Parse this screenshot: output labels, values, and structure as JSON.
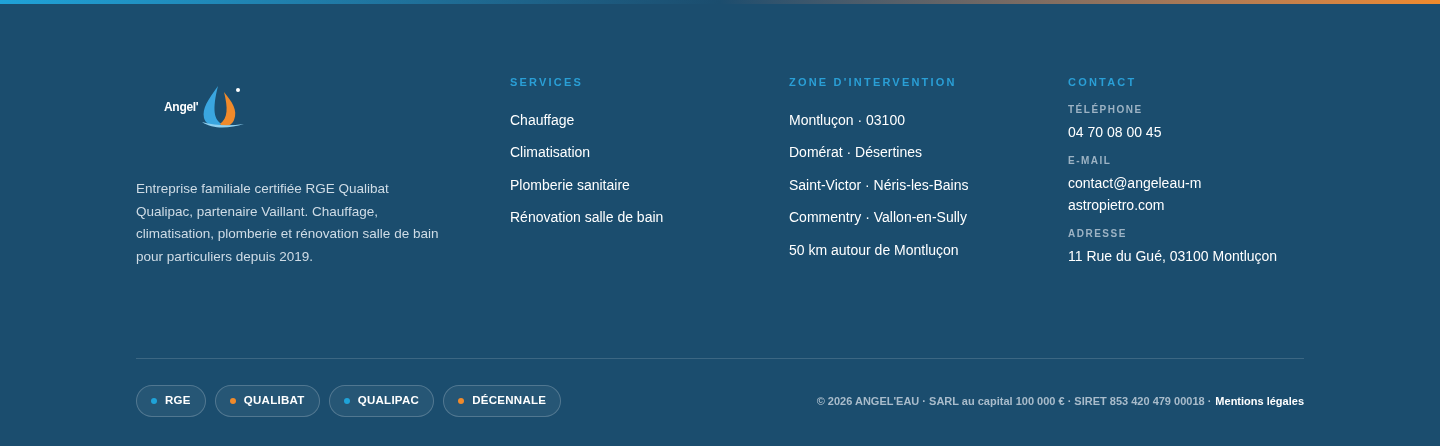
{
  "brand": {
    "logo_text": "Angel'",
    "description": "Entreprise familiale certifiée RGE Qualibat Qualipac, partenaire Vaillant. Chauffage, climatisation, plomberie et rénovation salle de bain pour particuliers depuis 2019."
  },
  "services": {
    "heading": "SERVICES",
    "items": [
      "Chauffage",
      "Climatisation",
      "Plomberie sanitaire",
      "Rénovation salle de bain"
    ]
  },
  "zone": {
    "heading": "ZONE D'INTERVENTION",
    "items": [
      "Montluçon · 03100",
      "Domérat · Désertines",
      "Saint-Victor · Néris-les-Bains",
      "Commentry · Vallon-en-Sully",
      "50 km autour de Montluçon"
    ]
  },
  "contact": {
    "heading": "CONTACT",
    "fields": [
      {
        "label": "TÉLÉPHONE",
        "value": "04 70 08 00 45"
      },
      {
        "label": "E-MAIL",
        "value": "contact@angeleau-mastropietro.com"
      },
      {
        "label": "ADRESSE",
        "value": "11 Rue du Gué, 03100 Montluçon"
      }
    ]
  },
  "badges": [
    {
      "label": "RGE",
      "color": "#1fa3d9"
    },
    {
      "label": "QUALIBAT",
      "color": "#f08a2b"
    },
    {
      "label": "QUALIPAC",
      "color": "#1fa3d9"
    },
    {
      "label": "DÉCENNALE",
      "color": "#f08a2b"
    }
  ],
  "legal": {
    "text": "© 2026 ANGEL'EAU · SARL au capital 100 000 € · SIRET 853 420 479 00018 ·",
    "link": "Mentions légales"
  }
}
